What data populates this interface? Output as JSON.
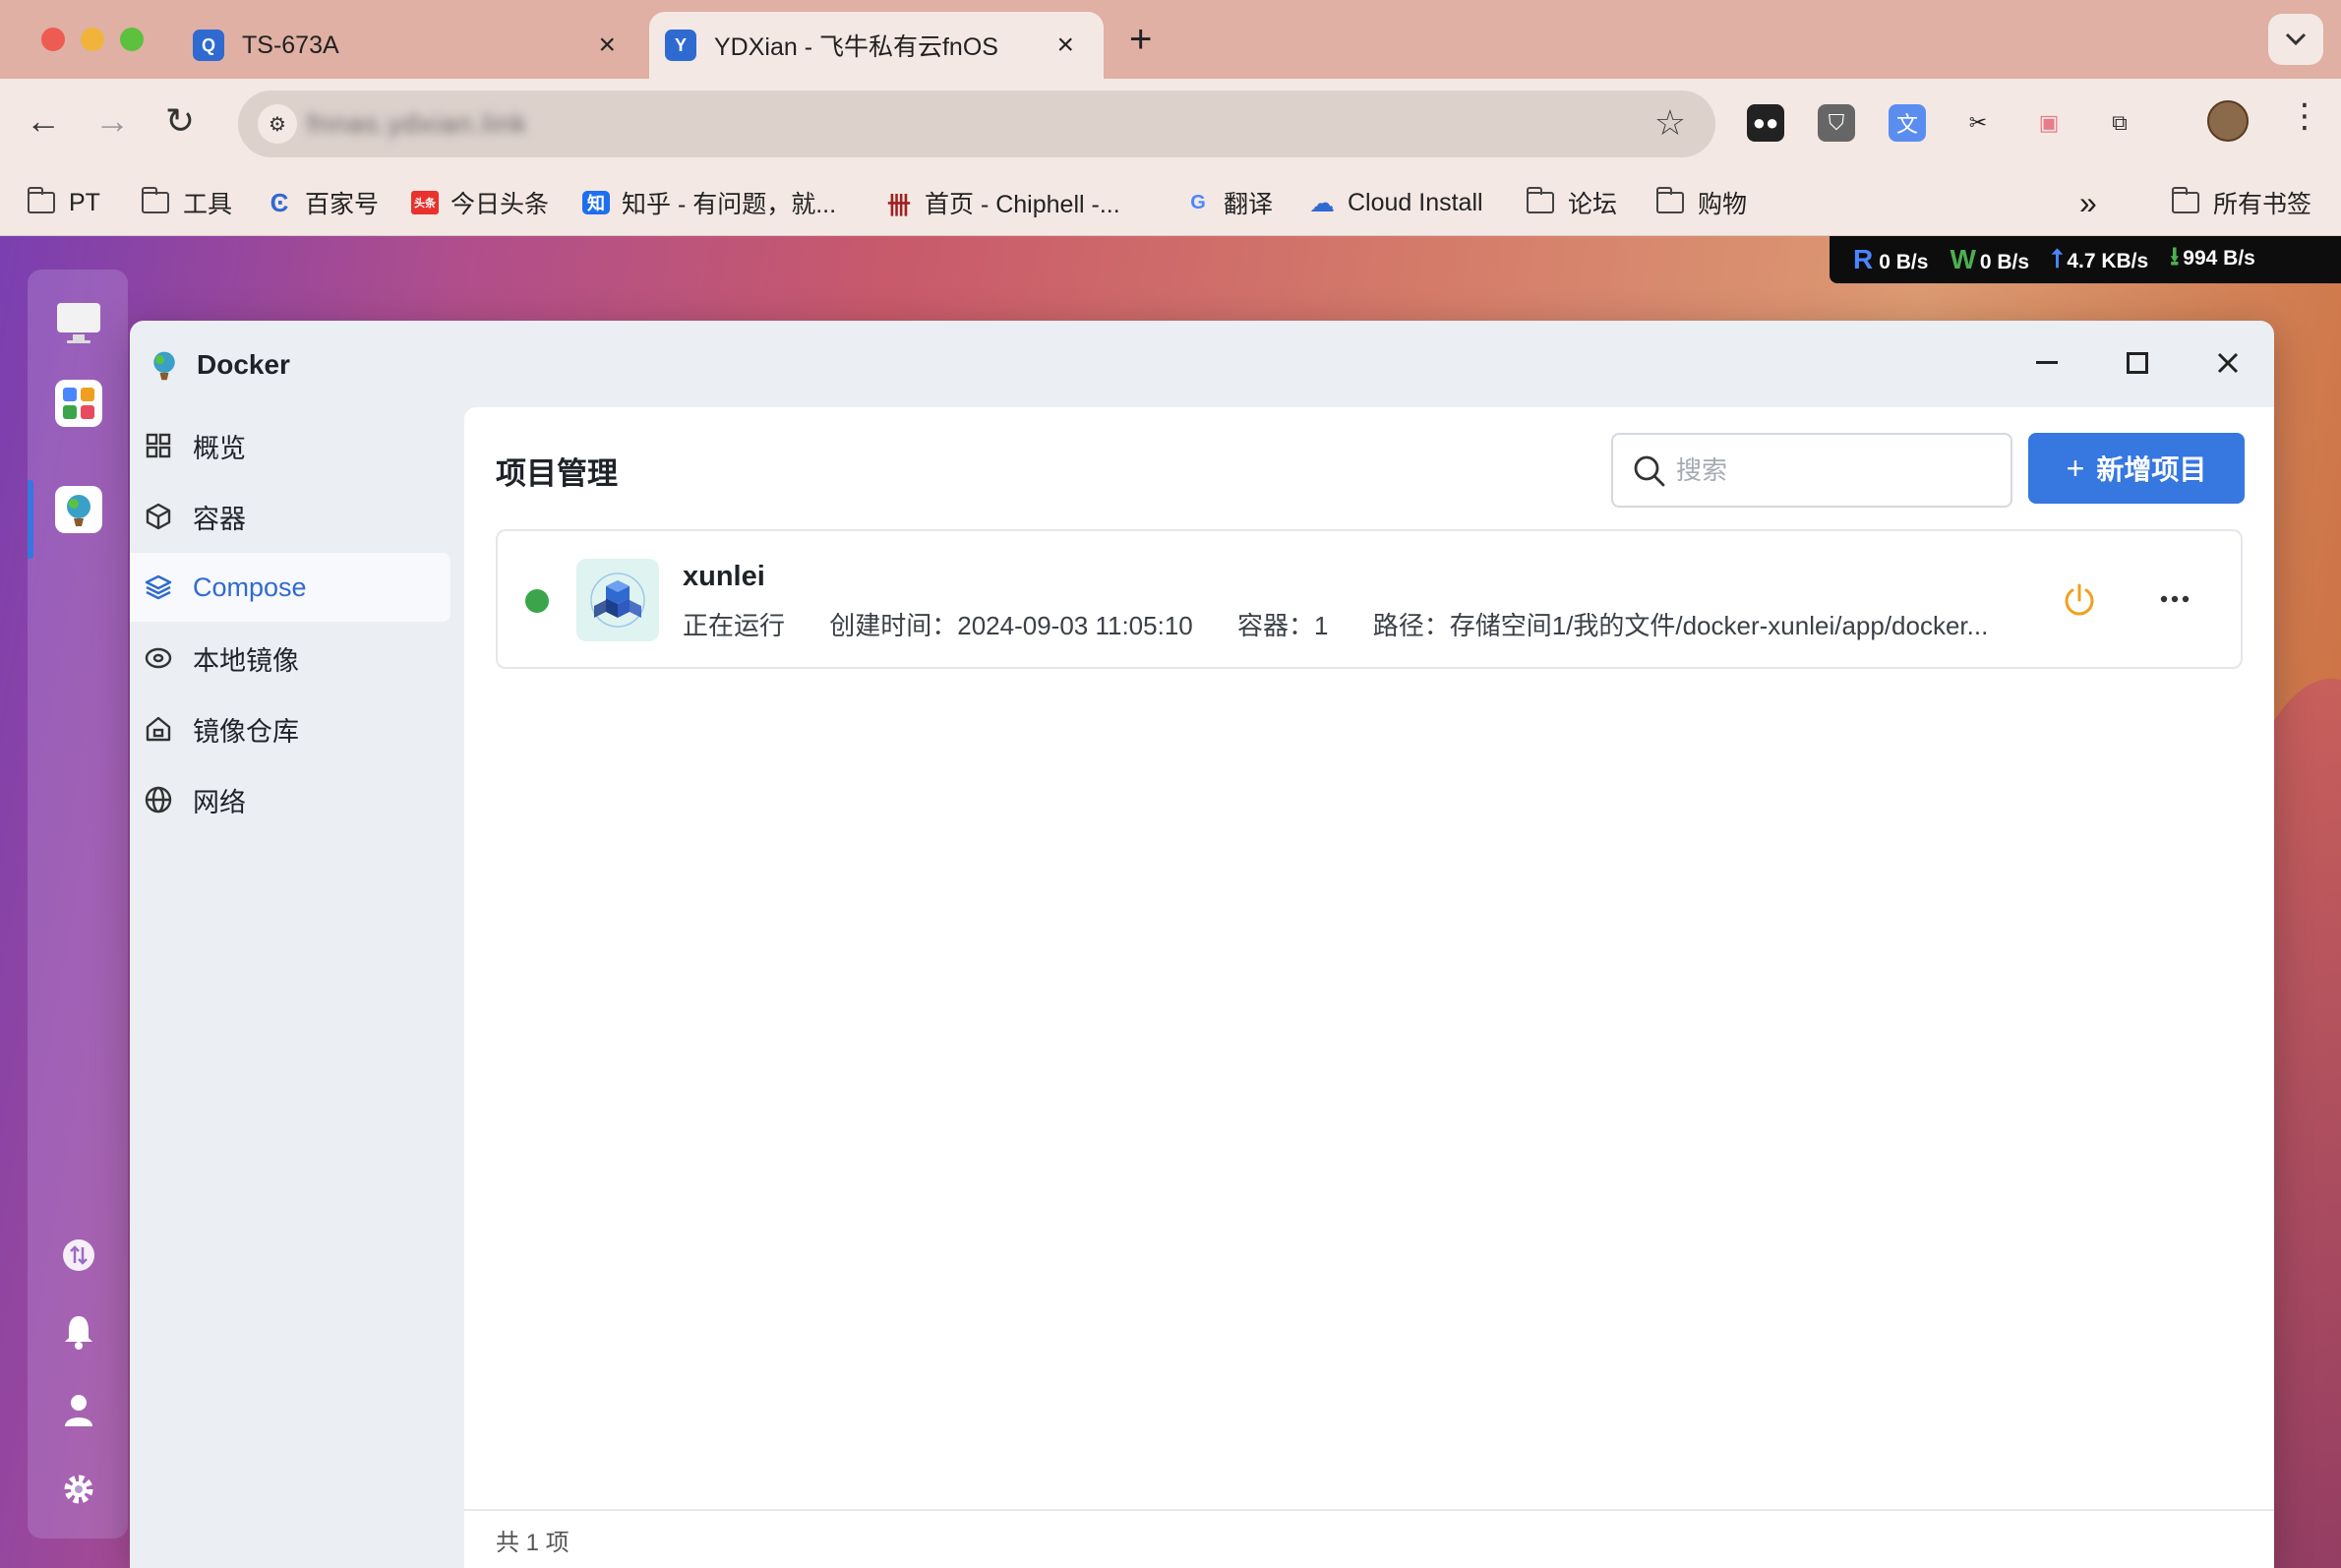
{
  "browser": {
    "tabs": [
      {
        "title": "TS-673A",
        "active": false
      },
      {
        "title": "YDXian - 飞牛私有云fnOS",
        "active": true
      }
    ],
    "url": "fnnas.ydxian.link",
    "bookmarks": [
      {
        "label": "PT",
        "icon": "folder-icon"
      },
      {
        "label": "工具",
        "icon": "folder-icon"
      },
      {
        "label": "百家号",
        "icon": "baijiahao-icon"
      },
      {
        "label": "今日头条",
        "icon": "toutiao-icon"
      },
      {
        "label": "知乎 - 有问题，就...",
        "icon": "zhihu-icon"
      },
      {
        "label": "首页 - Chiphell -...",
        "icon": "chiphell-icon"
      },
      {
        "label": "翻译",
        "icon": "translate-icon"
      },
      {
        "label": "Cloud Install",
        "icon": "cloud-icon"
      },
      {
        "label": "论坛",
        "icon": "folder-icon"
      },
      {
        "label": "购物",
        "icon": "folder-icon"
      }
    ],
    "all_bookmarks": "所有书签",
    "more_bookmarks": "»"
  },
  "netstat": {
    "read_letter": "R",
    "read": "0 B/s",
    "write_letter": "W",
    "write": "0 B/s",
    "upload": "4.7 KB/s",
    "download": "994 B/s"
  },
  "window": {
    "title": "Docker",
    "nav": [
      {
        "label": "概览",
        "icon": "grid-icon",
        "active": false
      },
      {
        "label": "容器",
        "icon": "box-icon",
        "active": false
      },
      {
        "label": "Compose",
        "icon": "layers-icon",
        "active": true
      },
      {
        "label": "本地镜像",
        "icon": "disk-icon",
        "active": false
      },
      {
        "label": "镜像仓库",
        "icon": "house-icon",
        "active": false
      },
      {
        "label": "网络",
        "icon": "globe-icon",
        "active": false
      }
    ],
    "content": {
      "title": "项目管理",
      "search_placeholder": "搜索",
      "add_button": "新增项目",
      "projects": [
        {
          "name": "xunlei",
          "status": "正在运行",
          "created": "创建时间：2024-09-03 11:05:10",
          "containers": "容器：1",
          "path": "路径：存储空间1/我的文件/docker-xunlei/app/docker...",
          "status_color": "#3aa54a"
        }
      ],
      "footer": "共 1 项"
    }
  },
  "colors": {
    "accent": "#3677e0",
    "nav_active": "#2f6ad0",
    "power": "#f0a020"
  }
}
